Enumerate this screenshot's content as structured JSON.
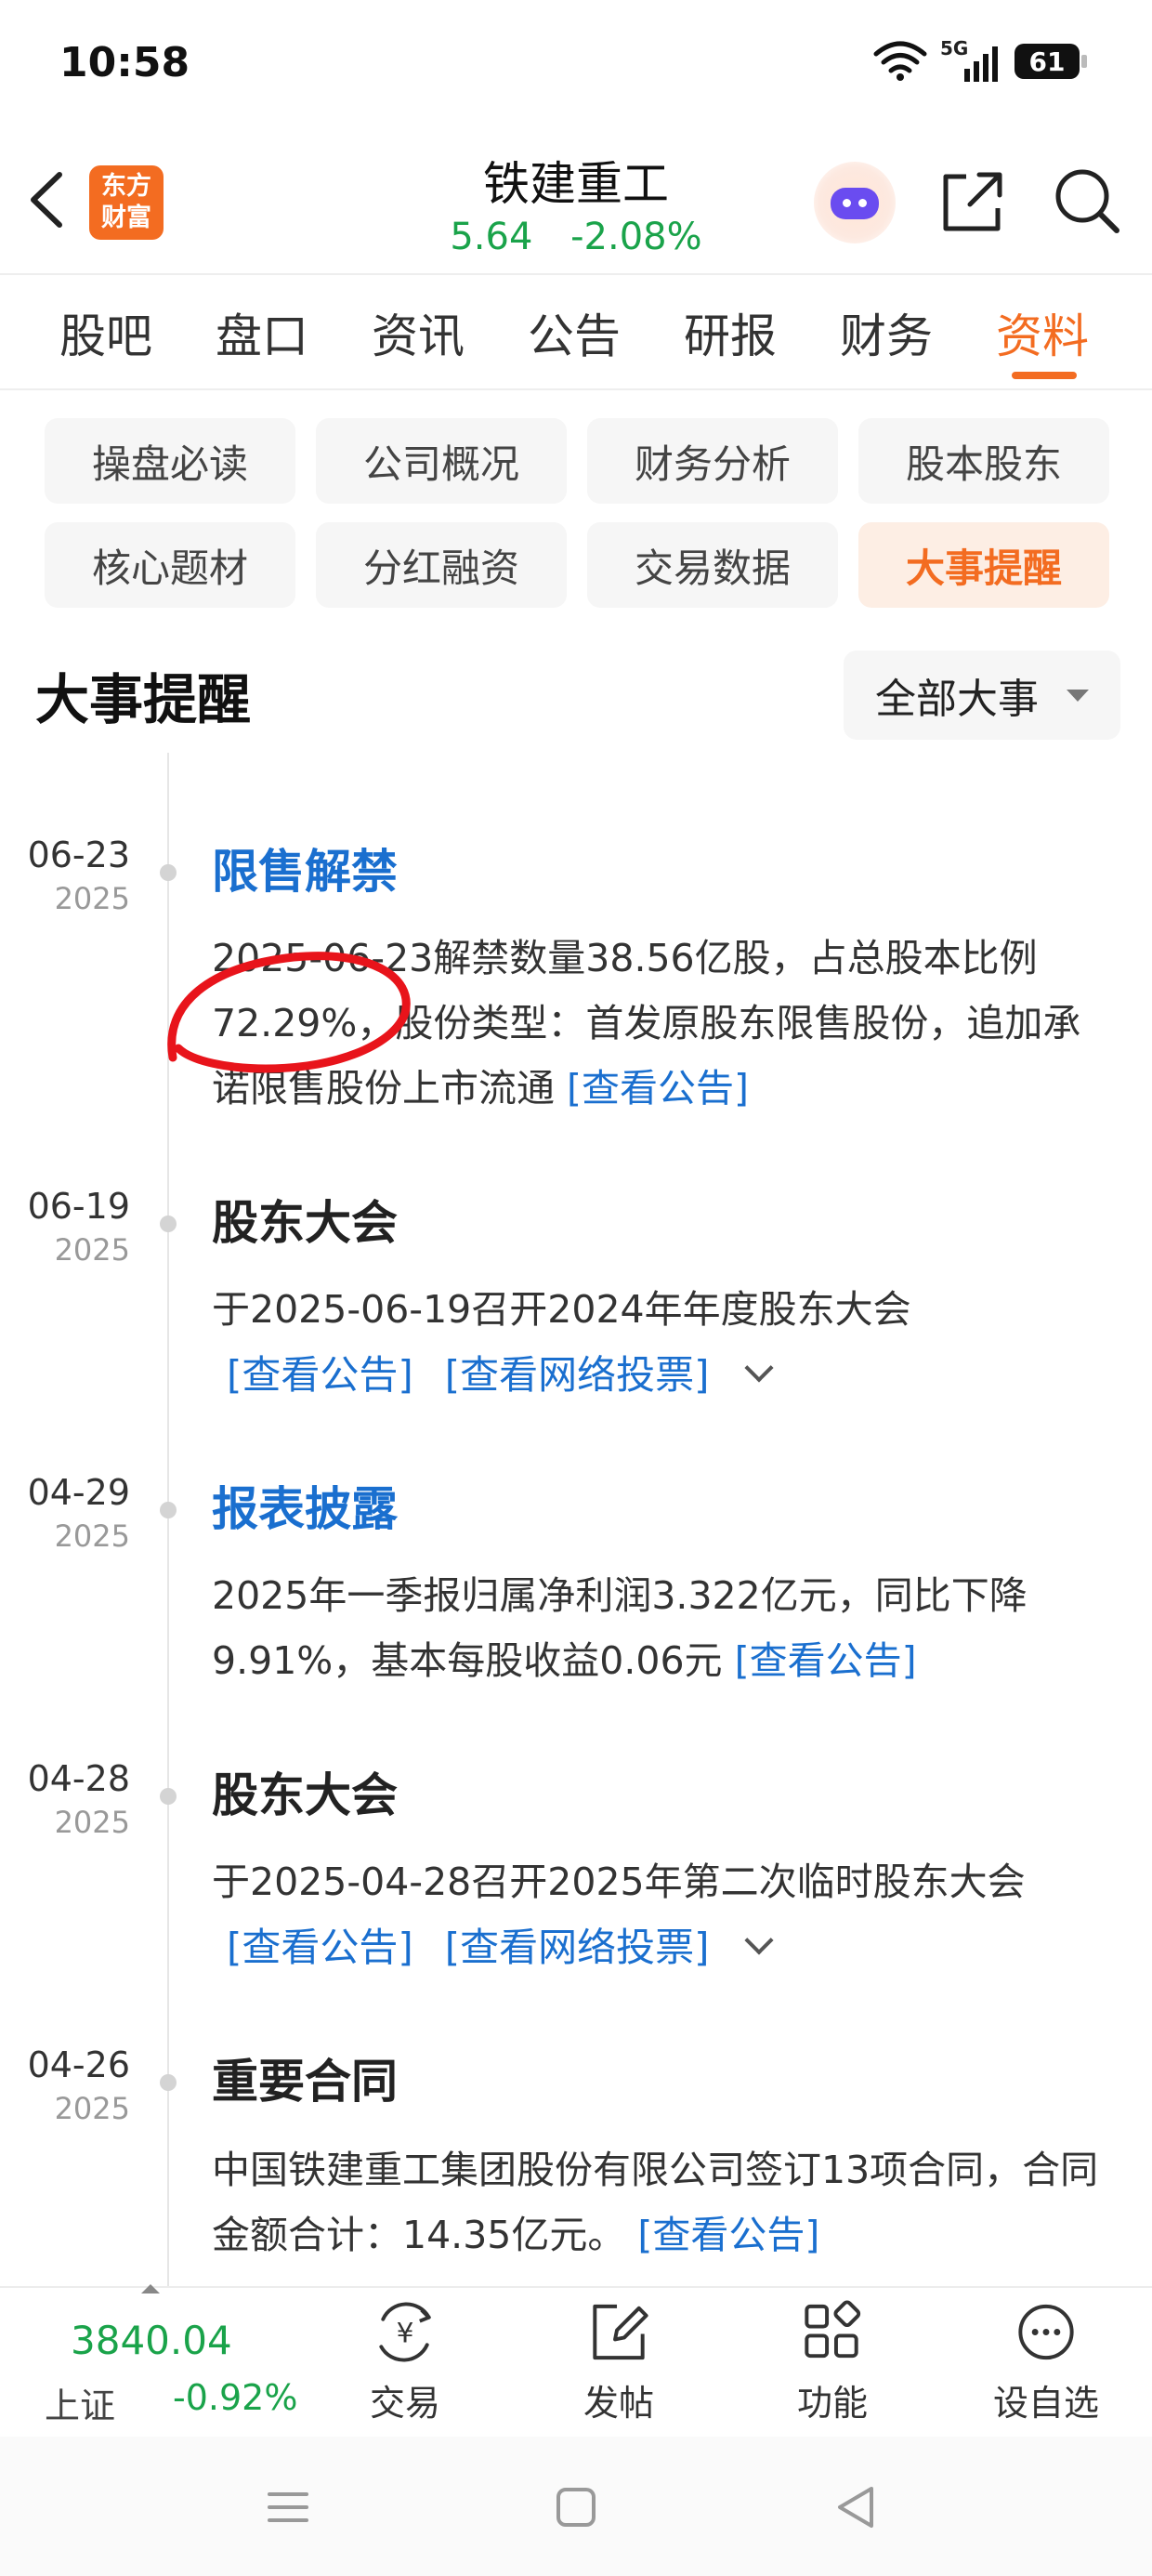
{
  "status_bar": {
    "time": "10:58",
    "network": "5G",
    "battery": "61"
  },
  "header": {
    "logo_line1": "东方",
    "logo_line2": "财富",
    "stock_name": "铁建重工",
    "price": "5.64",
    "change_pct": "-2.08%"
  },
  "tabs": [
    "股吧",
    "盘口",
    "资讯",
    "公告",
    "研报",
    "财务",
    "资料"
  ],
  "active_tab": "资料",
  "subcategories": [
    "操盘必读",
    "公司概况",
    "财务分析",
    "股本股东",
    "核心题材",
    "分红融资",
    "交易数据",
    "大事提醒"
  ],
  "section": {
    "title": "大事提醒",
    "filter_label": "全部大事"
  },
  "events": [
    {
      "date": "06-23",
      "year": "2025",
      "title": "限售解禁",
      "title_style": "link",
      "desc": "2025-06-23解禁数量38.56亿股，占总股本比例72.29%，股份类型：首发原股东限售股份，追加承诺限售股份上市流通",
      "link": "[查看公告]"
    },
    {
      "date": "06-19",
      "year": "2025",
      "title": "股东大会",
      "title_style": "plain",
      "desc": "于2025-06-19召开2024年年度股东大会",
      "link": "[查看公告]",
      "link2": "[查看网络投票]"
    },
    {
      "date": "04-29",
      "year": "2025",
      "title": "报表披露",
      "title_style": "link",
      "desc": "2025年一季报归属净利润3.322亿元，同比下降9.91%，基本每股收益0.06元",
      "link": "[查看公告]"
    },
    {
      "date": "04-28",
      "year": "2025",
      "title": "股东大会",
      "title_style": "plain",
      "desc": "于2025-04-28召开2025年第二次临时股东大会",
      "link": "[查看公告]",
      "link2": "[查看网络投票]"
    },
    {
      "date": "04-26",
      "year": "2025",
      "title": "重要合同",
      "title_style": "plain",
      "desc": "中国铁建重工集团股份有限公司签订13项合同，合同金额合计：14.35亿元。",
      "link": "[查看公告]"
    }
  ],
  "toolbar": {
    "index_value": "3840.04",
    "index_name": "上证",
    "index_change": "-0.92%",
    "items": [
      "交易",
      "发帖",
      "功能",
      "设自选"
    ]
  },
  "colors": {
    "accent": "#f36c21",
    "down": "#1aa34a",
    "link": "#1a6fcf",
    "annotation": "#e8141b"
  }
}
